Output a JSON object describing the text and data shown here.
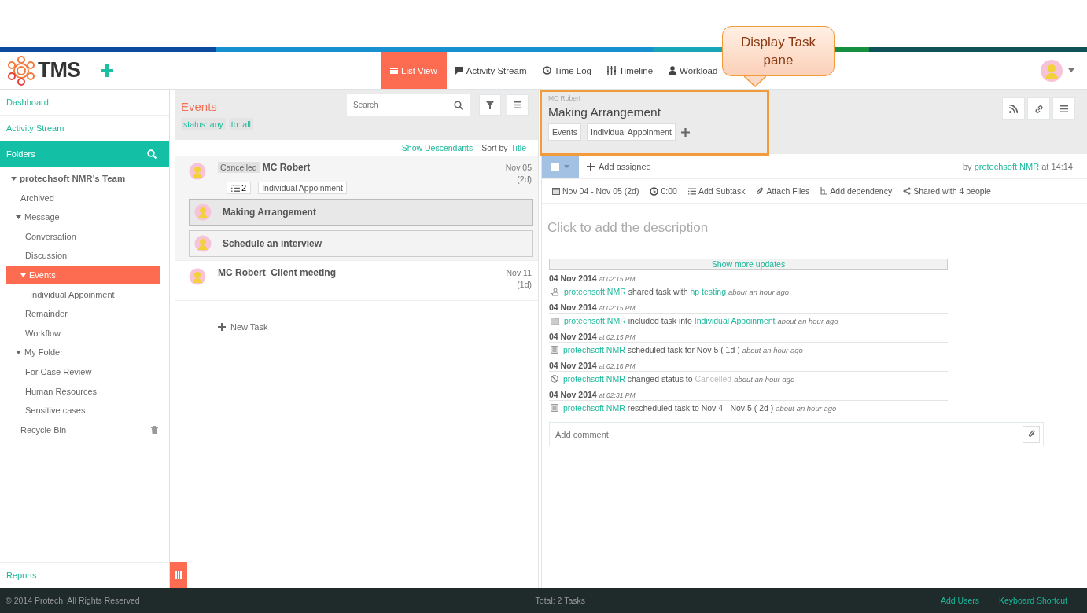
{
  "header": {
    "logo": "TMS",
    "nav": [
      {
        "label": "List View",
        "kind": "list",
        "selected": true
      },
      {
        "label": "Activity Stream",
        "kind": "comment",
        "selected": false
      },
      {
        "label": "Time Log",
        "kind": "clock",
        "selected": false
      },
      {
        "label": "Timeline",
        "kind": "sliders",
        "selected": false
      },
      {
        "label": "Workload",
        "kind": "user",
        "selected": false
      }
    ]
  },
  "callout": {
    "text": "Display Task pane"
  },
  "sidebar": {
    "links": [
      "Dashboard",
      "Activity Stream"
    ],
    "folders_title": "Folders",
    "tree": [
      {
        "label": "protechsoft NMR's Team",
        "expanded": true,
        "selected": false,
        "children": [
          {
            "label": "Archived",
            "selected": false
          },
          {
            "label": "Message",
            "expanded": true,
            "selected": false,
            "children": [
              {
                "label": "Conversation",
                "selected": false
              },
              {
                "label": "Discussion",
                "selected": false
              },
              {
                "label": "Events",
                "expanded": true,
                "selected": true,
                "children": [
                  {
                    "label": "Individual Appoinment",
                    "selected": false
                  }
                ]
              },
              {
                "label": "Remainder",
                "selected": false
              },
              {
                "label": "Workflow",
                "selected": false
              }
            ]
          },
          {
            "label": "My Folder",
            "expanded": true,
            "selected": false,
            "children": [
              {
                "label": "For Case Review",
                "selected": false
              },
              {
                "label": "Human Resources",
                "selected": false
              },
              {
                "label": "Sensitive cases",
                "selected": false
              }
            ]
          },
          {
            "label": "Recycle Bin",
            "selected": false,
            "trash": true
          }
        ]
      }
    ],
    "reports": "Reports"
  },
  "list": {
    "title": "Events",
    "search": {
      "placeholder": "Search"
    },
    "filters": [
      "status: any",
      "to: all"
    ],
    "show_descendants": "Show Descendants",
    "sort_label": "Sort by",
    "sort_value": "Title",
    "tasks": [
      {
        "status": "Cancelled",
        "title": "MC Robert",
        "date": "Nov 05",
        "duration": "(2d)",
        "subtask_count": "2",
        "tag": "Individual Appoinment",
        "subtasks": [
          {
            "title": "Making Arrangement",
            "selected": true
          },
          {
            "title": "Schedule an interview",
            "selected": false
          }
        ]
      },
      {
        "title": "MC Robert_Client meeting",
        "date": "Nov 11",
        "duration": "(1d)"
      }
    ],
    "new_task": "New Task"
  },
  "task": {
    "parent": "MC Robert",
    "title": "Making Arrangement",
    "tags": [
      "Events",
      "Individual Appoinment"
    ],
    "checked": false,
    "add_assignee": "Add assignee",
    "by_label": "by",
    "by_user": "protechsoft NMR",
    "by_time": "at 14:14",
    "meta": [
      {
        "kind": "calendar",
        "label": "Nov 04 - Nov 05 (2d)"
      },
      {
        "kind": "clock",
        "label": "0:00"
      },
      {
        "kind": "subtask",
        "label": "Add Subtask"
      },
      {
        "kind": "clip",
        "label": "Attach Files"
      },
      {
        "kind": "dependency",
        "label": "Add dependency"
      },
      {
        "kind": "share",
        "label": "Shared with 4 people"
      }
    ],
    "description_placeholder": "Click to add the description",
    "show_more": "Show more updates",
    "activity": [
      {
        "date": "04 Nov 2014",
        "time": "at 02:15 PM",
        "kind": "share",
        "actor": "protechsoft NMR",
        "action": "shared task with",
        "target_link": "hp testing",
        "ago": "about an hour ago"
      },
      {
        "date": "04 Nov 2014",
        "time": "at 02:15 PM",
        "kind": "folder",
        "actor": "protechsoft NMR",
        "action": "included task into",
        "target_link": "Individual Appoinment",
        "ago": "about an hour ago"
      },
      {
        "date": "04 Nov 2014",
        "time": "at 02:15 PM",
        "kind": "schedule",
        "actor": "protechsoft NMR",
        "action": "scheduled task for Nov 5 ( 1d )",
        "ago": "about an hour ago"
      },
      {
        "date": "04 Nov 2014",
        "time": "at 02:16 PM",
        "kind": "status",
        "actor": "protechsoft NMR",
        "action": "changed status to",
        "target_status": "Cancelled",
        "ago": "about an hour ago"
      },
      {
        "date": "04 Nov 2014",
        "time": "at 02:31 PM",
        "kind": "schedule",
        "actor": "protechsoft NMR",
        "action": "rescheduled task to Nov 4 - Nov 5 ( 2d )",
        "ago": "about an hour ago"
      }
    ],
    "comment_placeholder": "Add comment"
  },
  "footer": {
    "copyright": "© 2014 Protech, All Rights Reserved",
    "total": "Total: 2 Tasks",
    "links": [
      "Add Users",
      "Keyboard Shortcut"
    ]
  }
}
